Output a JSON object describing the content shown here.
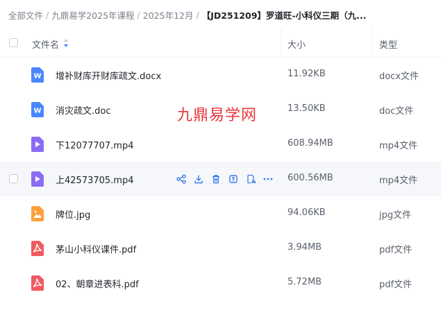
{
  "breadcrumb": {
    "items": [
      "全部文件",
      "九鼎易学2025年课程",
      "2025年12月"
    ],
    "separator": "/",
    "current": "【JD251209】罗道旺-小科仪三期（九..."
  },
  "table": {
    "select_all_label": "",
    "columns": {
      "name": "文件名",
      "size": "大小",
      "type": "类型"
    },
    "sort_icon": "sort-icon"
  },
  "files": [
    {
      "name": "增补财库开财库疏文.docx",
      "size": "11.92KB",
      "type": "docx文件",
      "icon": "word-doc-icon"
    },
    {
      "name": "消灾疏文.doc",
      "size": "13.50KB",
      "type": "doc文件",
      "icon": "word-doc-icon"
    },
    {
      "name": "下12077707.mp4",
      "size": "608.94MB",
      "type": "mp4文件",
      "icon": "video-file-icon"
    },
    {
      "name": "上42573705.mp4",
      "size": "600.56MB",
      "type": "mp4文件",
      "icon": "video-file-icon"
    },
    {
      "name": "牌位.jpg",
      "size": "94.06KB",
      "type": "jpg文件",
      "icon": "image-file-icon"
    },
    {
      "name": "茅山小科仪课件.pdf",
      "size": "3.94MB",
      "type": "pdf文件",
      "icon": "pdf-file-icon"
    },
    {
      "name": "02、朝章进表科.pdf",
      "size": "5.72MB",
      "type": "pdf文件",
      "icon": "pdf-file-icon"
    }
  ],
  "hovered_row_actions": [
    "share-icon",
    "download-icon",
    "delete-icon",
    "rename-icon",
    "copy-icon",
    "more-icon"
  ],
  "watermark": "九鼎易学网",
  "colors": {
    "word": "#4a86ff",
    "video": "#8b6cf6",
    "image": "#ff9f3a",
    "pdf": "#f05a60",
    "action": "#3b7cf0",
    "watermark": "#e8343b"
  }
}
